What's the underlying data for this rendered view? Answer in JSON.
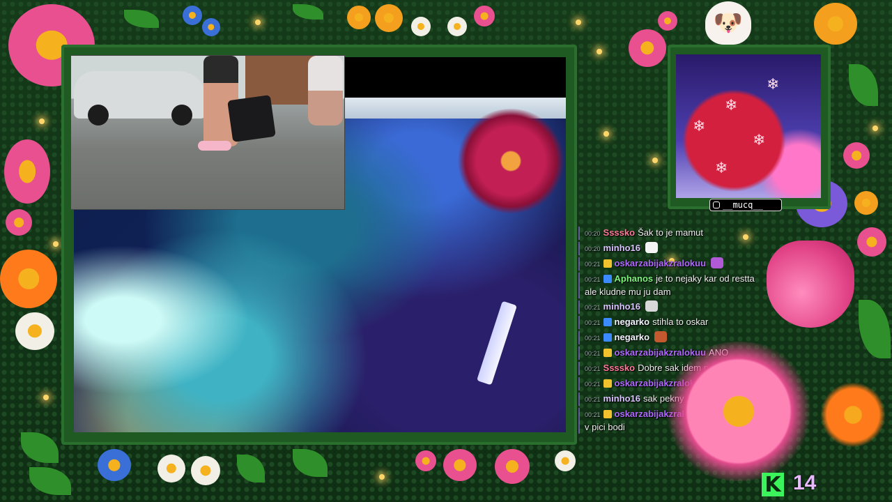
{
  "overlay": {
    "instagram_handle": "__mucq__",
    "viewer_count": "14",
    "platform_logo_letter": "K",
    "colors": {
      "frame_green": "#1f5a23",
      "kick_green": "#3bf35a",
      "viewer_text": "#e7b8ff"
    }
  },
  "chat": {
    "messages": [
      {
        "time": "00:20",
        "user": "Ssssko",
        "user_color": "#ff7a9a",
        "text": "Šak to je mamut",
        "badge": "",
        "emote": ""
      },
      {
        "time": "00:20",
        "user": "minho16",
        "user_color": "#d9c6ff",
        "text": "",
        "badge": "",
        "emote": "pepe-emote"
      },
      {
        "time": "00:21",
        "user": "oskarzabijakzralokuu",
        "user_color": "#b069ff",
        "text": "",
        "badge": "crown",
        "emote": "gem-emote"
      },
      {
        "time": "00:21",
        "user": "Aphanos",
        "user_color": "#7df57d",
        "text": "je to nejaky kar od restta ale kludne mu ju dam",
        "badge": "sub",
        "emote": ""
      },
      {
        "time": "00:21",
        "user": "minho16",
        "user_color": "#d9c6ff",
        "text": "",
        "badge": "",
        "emote": "cat-emote"
      },
      {
        "time": "00:21",
        "user": "negarko",
        "user_color": "#f5f5ff",
        "text": "stihla to oskar",
        "badge": "sub",
        "emote": ""
      },
      {
        "time": "00:21",
        "user": "negarko",
        "user_color": "#f5f5ff",
        "text": "",
        "badge": "sub",
        "emote": "face-emote"
      },
      {
        "time": "00:21",
        "user": "oskarzabijakzralokuu",
        "user_color": "#b069ff",
        "text": "ANO",
        "badge": "crown",
        "emote": ""
      },
      {
        "time": "00:21",
        "user": "Ssssko",
        "user_color": "#ff7a9a",
        "text": "Dobre sak idem preč teda",
        "badge": "",
        "emote": ""
      },
      {
        "time": "00:21",
        "user": "oskarzabijakzralokuu",
        "user_color": "#b069ff",
        "text": "",
        "badge": "crown",
        "emote": "smile-emote"
      },
      {
        "time": "00:21",
        "user": "minho16",
        "user_color": "#d9c6ff",
        "text": "sak pekny je ten kvietok",
        "badge": "",
        "emote": ""
      },
      {
        "time": "00:21",
        "user": "oskarzabijakzralokuu",
        "user_color": "#b069ff",
        "text": "pochybovači v pici bodi",
        "badge": "crown",
        "emote": ""
      }
    ]
  }
}
